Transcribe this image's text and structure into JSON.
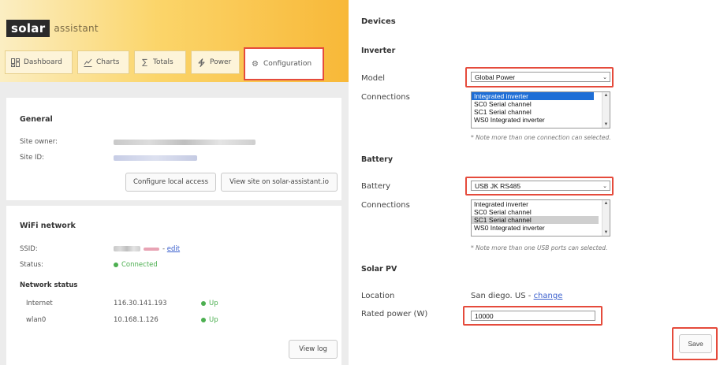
{
  "brand": {
    "name_bold": "solar",
    "name_rest": "assistant"
  },
  "nav": {
    "tabs": [
      {
        "label": "Dashboard",
        "icon": "dashboard-grid-icon"
      },
      {
        "label": "Charts",
        "icon": "chart-icon"
      },
      {
        "label": "Totals",
        "icon": "sigma-icon"
      },
      {
        "label": "Power",
        "icon": "lightning-icon"
      },
      {
        "label": "Configuration",
        "icon": "gear-icon",
        "active": true
      }
    ]
  },
  "general": {
    "title": "General",
    "site_owner_label": "Site owner:",
    "site_id_label": "Site ID:",
    "configure_button": "Configure local access",
    "view_site_button": "View site on solar-assistant.io"
  },
  "wifi": {
    "title": "WiFi network",
    "ssid_label": "SSID:",
    "ssid_edit": "edit",
    "status_label": "Status:",
    "status_value": "Connected",
    "network_status_title": "Network status",
    "rows": [
      {
        "name": "Internet",
        "ip": "116.30.141.193",
        "state": "Up"
      },
      {
        "name": "wlan0",
        "ip": "10.168.1.126",
        "state": "Up"
      }
    ],
    "view_log_button": "View log"
  },
  "devices": {
    "title": "Devices",
    "inverter": {
      "title": "Inverter",
      "model_label": "Model",
      "model_value": "Global Power",
      "connections_label": "Connections",
      "connections": [
        "Integrated inverter",
        "SC0 Serial channel",
        "SC1 Serial channel",
        "WS0 Integrated inverter"
      ],
      "note": "* Note more than one connection can selected."
    },
    "battery": {
      "title": "Battery",
      "battery_label": "Battery",
      "battery_value": "USB JK RS485",
      "connections_label": "Connections",
      "connections": [
        "Integrated inverter",
        "SC0 Serial channel",
        "SC1 Serial channel",
        "WS0 Integrated inverter"
      ],
      "note": "* Note more than one USB ports can selected."
    },
    "solar": {
      "title": "Solar PV",
      "location_label": "Location",
      "location_value": "San diego. US -",
      "location_change": "change",
      "rated_power_label": "Rated power (W)",
      "rated_power_value": "10000"
    },
    "save_button": "Save"
  },
  "colors": {
    "highlight": "#e54b3c",
    "accent_yellow": "#f8b838",
    "ok_green": "#4caf50",
    "select_blue": "#1e6ed6"
  }
}
